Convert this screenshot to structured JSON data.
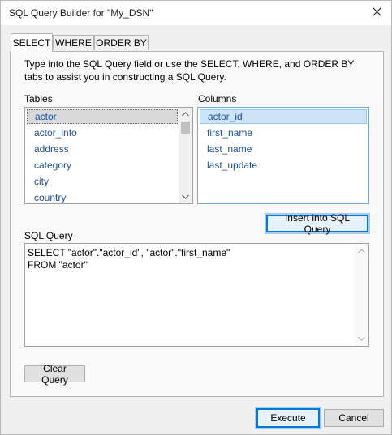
{
  "window": {
    "title": "SQL Query Builder for \"My_DSN\"",
    "close_icon": "close-icon"
  },
  "tabs": [
    {
      "label": "SELECT",
      "active": true
    },
    {
      "label": "WHERE",
      "active": false
    },
    {
      "label": "ORDER BY",
      "active": false
    }
  ],
  "select_tab": {
    "instructions": "Type into the SQL Query field or use the SELECT, WHERE, and ORDER BY tabs to assist you in constructing a SQL Query.",
    "tables_label": "Tables",
    "columns_label": "Columns",
    "tables": [
      "actor",
      "actor_info",
      "address",
      "category",
      "city",
      "country"
    ],
    "selected_table": "actor",
    "columns": [
      "actor_id",
      "first_name",
      "last_name",
      "last_update"
    ],
    "selected_column": "actor_id",
    "insert_button": "Insert into SQL Query",
    "sql_label": "SQL Query",
    "sql_query": "SELECT \"actor\".\"actor_id\", \"actor\".\"first_name\"\nFROM \"actor\"",
    "clear_button": "Clear Query"
  },
  "footer": {
    "execute_button": "Execute",
    "cancel_button": "Cancel"
  },
  "colors": {
    "link_text": "#1a4fa0",
    "focus_accent": "#0078d7",
    "selection_blue": "#cce4f7"
  }
}
